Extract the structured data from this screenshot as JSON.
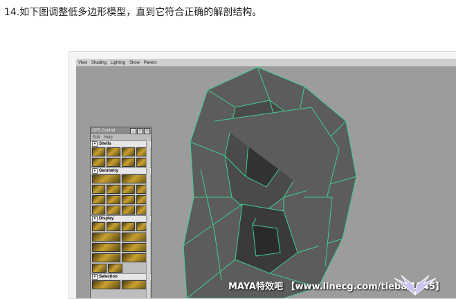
{
  "instruction": "14.如下图调整低多边形模型，直到它符合正确的解剖结构。",
  "viewport_menu": [
    "View",
    "Shading",
    "Lighting",
    "Show",
    "Panels"
  ],
  "panel": {
    "title": "CPS Control",
    "menu": [
      "Edit",
      "Help"
    ],
    "sections": [
      "Shells",
      "Geometry",
      "Display",
      "Selection"
    ]
  },
  "watermark": "MAYA特效吧 【www.linecg.com/tieba/1745】",
  "colors": {
    "viewport_bg": "#9c9c9c",
    "mesh_fill": "#5c5c5c",
    "mesh_edge": "#3fd08f"
  }
}
